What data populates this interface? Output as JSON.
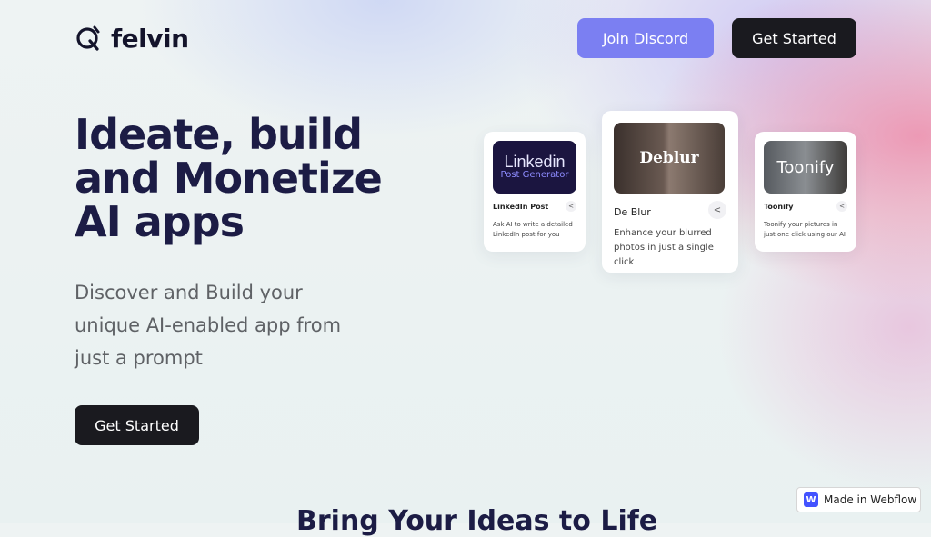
{
  "brand": {
    "name": "felvin",
    "icon": "felvin-logo-icon"
  },
  "nav": {
    "discord_label": "Join Discord",
    "get_started_label": "Get Started"
  },
  "hero": {
    "title": "Ideate, build and Monetize AI apps",
    "subtitle": "Discover and Build your unique AI-enabled app from just a prompt",
    "cta_label": "Get Started"
  },
  "cards": {
    "linkedin": {
      "thumb_line1": "Linkedin",
      "thumb_line2": "Post Generator",
      "name": "LinkedIn Post",
      "description": "Ask AI to write a detailed LinkedIn post for you",
      "share_icon": "share-icon"
    },
    "deblur": {
      "thumb_text": "Deblur",
      "name": "De Blur",
      "description": "Enhance your blurred photos in just a single click",
      "share_icon": "share-icon"
    },
    "toonify": {
      "thumb_text": "Toonify",
      "name": "Toonify",
      "description": "Toonify your pictures in just one click using our AI",
      "share_icon": "share-icon"
    }
  },
  "section": {
    "title": "Bring Your Ideas to Life"
  },
  "webflow_badge": {
    "icon_letter": "W",
    "label": "Made in Webflow"
  },
  "colors": {
    "accent": "#7b7ff2",
    "dark": "#1a1a1f",
    "heading": "#1c1c45"
  }
}
